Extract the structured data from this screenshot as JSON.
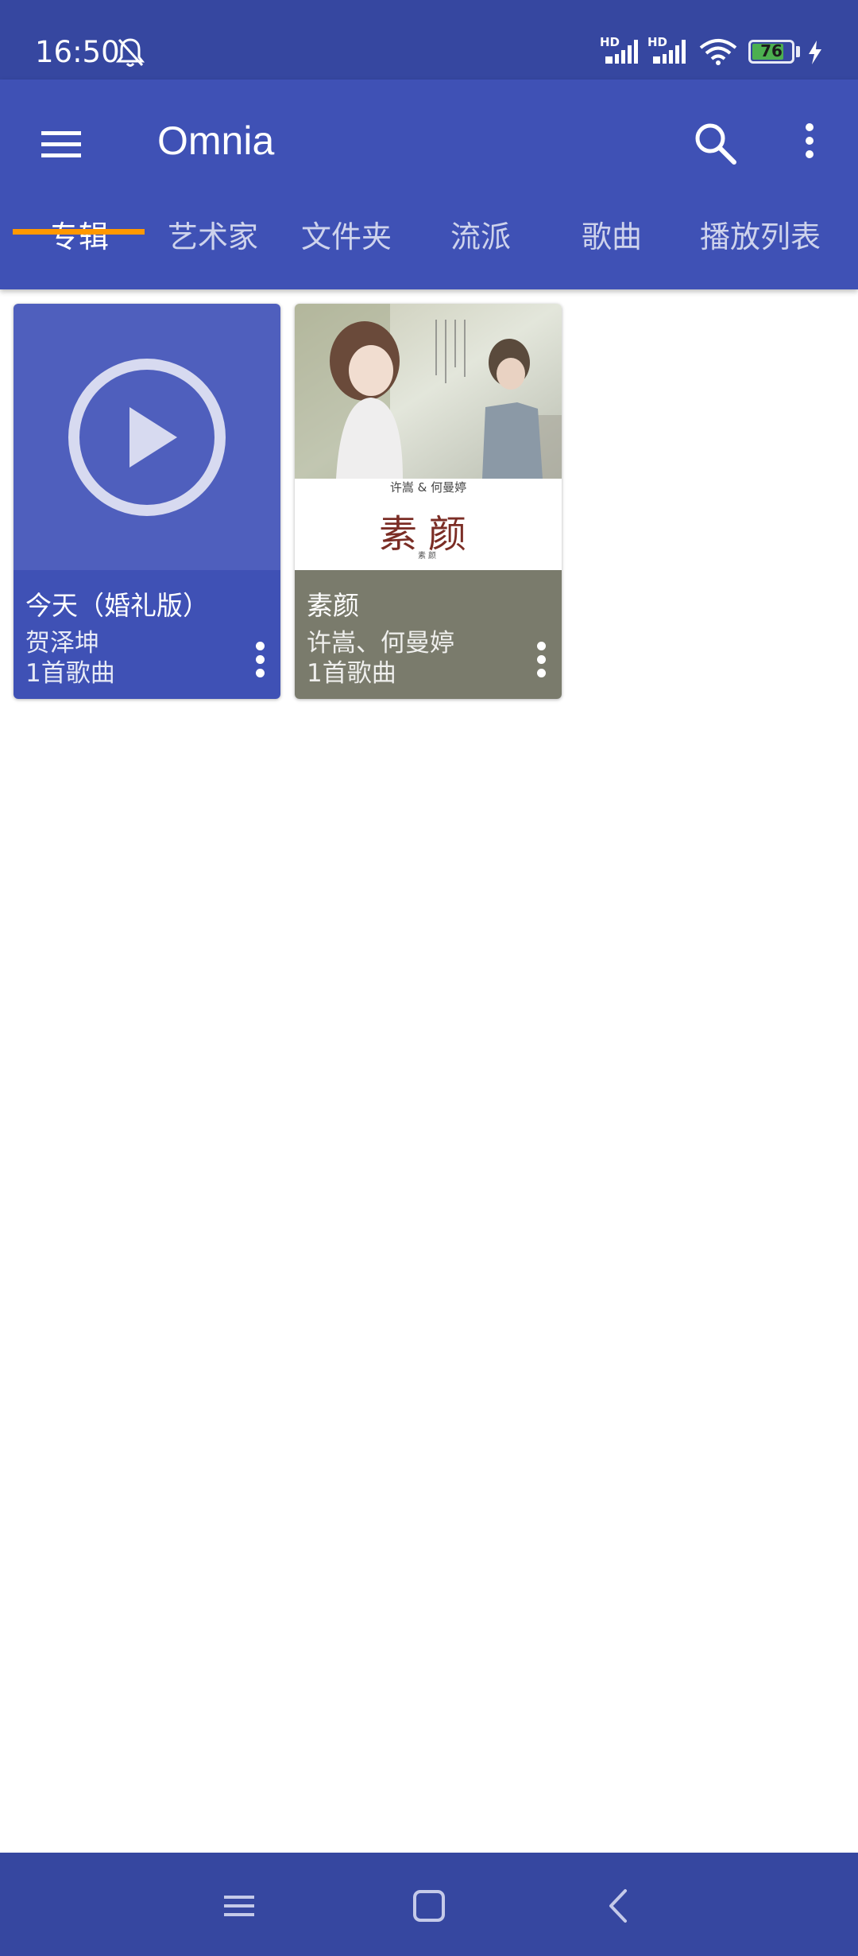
{
  "status_bar": {
    "time": "16:50",
    "hd_label_1": "HD",
    "hd_label_2": "HD",
    "battery_level": "76",
    "icons": [
      "bell-off-icon",
      "signal-icon",
      "wifi-icon",
      "battery-icon",
      "charging-icon"
    ]
  },
  "app_bar": {
    "title": "Omnia",
    "icons": [
      "menu-icon",
      "search-icon",
      "more-vert-icon"
    ]
  },
  "tabs": [
    {
      "label": "专辑",
      "active": true
    },
    {
      "label": "艺术家",
      "active": false
    },
    {
      "label": "文件夹",
      "active": false
    },
    {
      "label": "流派",
      "active": false
    },
    {
      "label": "歌曲",
      "active": false
    },
    {
      "label": "播放列表",
      "active": false
    }
  ],
  "albums": [
    {
      "title": "今天（婚礼版）",
      "artist": "贺泽坤",
      "count": "1首歌曲",
      "info_color": "#3f51b5",
      "art": "play-icon placeholder"
    },
    {
      "title": "素颜",
      "artist": "许嵩、何曼婷",
      "count": "1首歌曲",
      "info_color": "#7a7b6c",
      "cover_text": {
        "artists": "许嵩 & 何曼婷",
        "title_big": "素颜",
        "subtitle": "素颜"
      }
    }
  ],
  "nav_bar": {
    "icons": [
      "recents-icon",
      "home-icon",
      "back-icon"
    ]
  },
  "colors": {
    "primary": "#3f51b5",
    "status": "#3647a0",
    "accent": "#ff9800"
  }
}
